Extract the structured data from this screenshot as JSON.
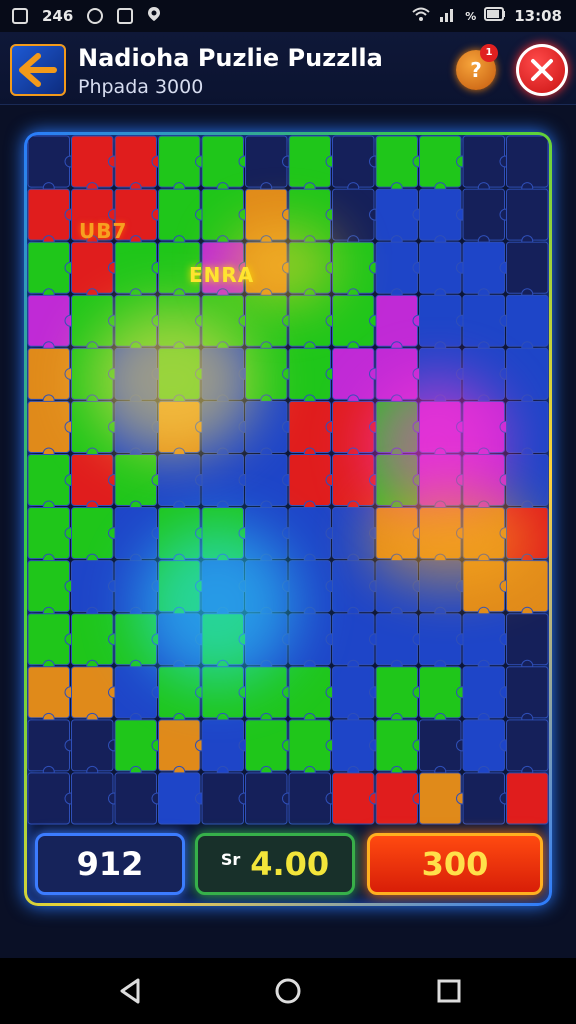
{
  "status_bar": {
    "left_text": "246",
    "time": "13:08",
    "battery_text": "%"
  },
  "header": {
    "title": "Nadioha Puzlie Puzzlla",
    "subtitle": "Phpada 3000",
    "hint_label": "?",
    "hint_badge": "1"
  },
  "board": {
    "label_1": "UB7",
    "label_2": "ENRA",
    "rows": 13,
    "cols": 12,
    "colors": {
      "red": "#e01d1d",
      "green": "#1fc61a",
      "orange": "#e08a1a",
      "magenta": "#c02ad6",
      "blue": "#1e45c8",
      "empty": "#15205a"
    }
  },
  "scores": {
    "blue_value": "912",
    "green_prefix": "Sr",
    "green_value": "4.00",
    "orange_value": "300"
  },
  "navbar": {
    "back": "back-icon",
    "home": "home-icon",
    "recents": "recents-icon"
  }
}
